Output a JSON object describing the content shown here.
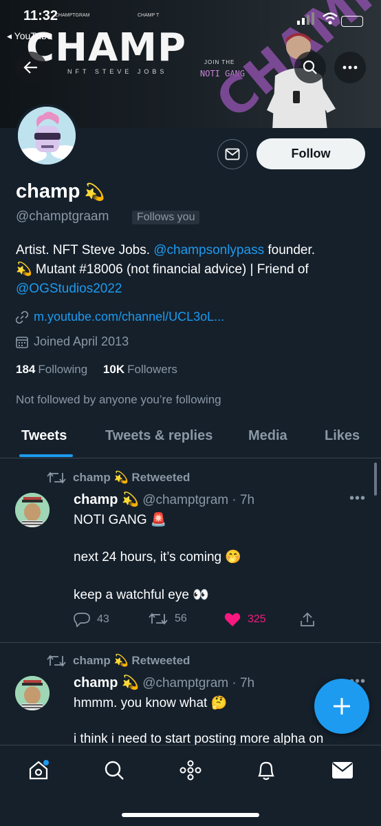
{
  "status_bar": {
    "time": "11:32",
    "back_app": "◂ YouTube",
    "banner_mini_left": "CHAMPTGRAM",
    "banner_mini_right": "CHAMP T"
  },
  "banner": {
    "brand": "CHAMP",
    "tagline": "NFT STEVE JOBS",
    "join": "JOIN THE",
    "gang": "NOTI GANG",
    "side_text": "CHAMP"
  },
  "profile": {
    "name": "champ",
    "name_emoji": "💫",
    "handle": "@champtgraam",
    "follows_you": "Follows you",
    "follow_label": "Follow",
    "bio_line1_pre": "Artist. NFT Steve Jobs. ",
    "bio_line1_link": "@champsonlypass",
    "bio_line1_post": " founder.",
    "bio_line2": "💫 Mutant #18006 (not financial advice) | Friend of",
    "bio_line3_link": "@OGStudios2022",
    "website": "m.youtube.com/channel/UCL3oL...",
    "joined": "Joined April 2013",
    "following_count": "184",
    "following_label": "Following",
    "followers_count": "10K",
    "followers_label": "Followers",
    "not_followed": "Not followed by anyone you’re following"
  },
  "tabs": [
    "Tweets",
    "Tweets & replies",
    "Media",
    "Likes"
  ],
  "tweets": [
    {
      "retweet_label": "champ 💫 Retweeted",
      "name": "champ 💫",
      "handle_time": "@champtgram · 7h",
      "more": "•••",
      "lines": [
        "NOTI GANG 🚨",
        "next 24 hours, it’s coming 🤭",
        "keep a watchful eye 👀"
      ],
      "replies": "43",
      "retweets": "56",
      "likes": "325"
    },
    {
      "retweet_label": "champ 💫 Retweeted",
      "name": "champ 💫",
      "handle_time": "@champtgram · 7h",
      "more": "•••",
      "lines": [
        "hmmm. you know what 🤔",
        "i think i need to start posting more alpha on"
      ]
    }
  ],
  "colors": {
    "background": "#15202b",
    "accent": "#1d9bf0",
    "like": "#f91880",
    "muted": "#8b98a5"
  },
  "icons": [
    "back-arrow-icon",
    "search-icon",
    "more-icon",
    "mail-icon",
    "link-icon",
    "calendar-icon",
    "retweet-icon",
    "reply-icon",
    "heart-icon",
    "share-icon",
    "plus-icon",
    "home-icon",
    "spaces-icon",
    "bell-icon"
  ]
}
